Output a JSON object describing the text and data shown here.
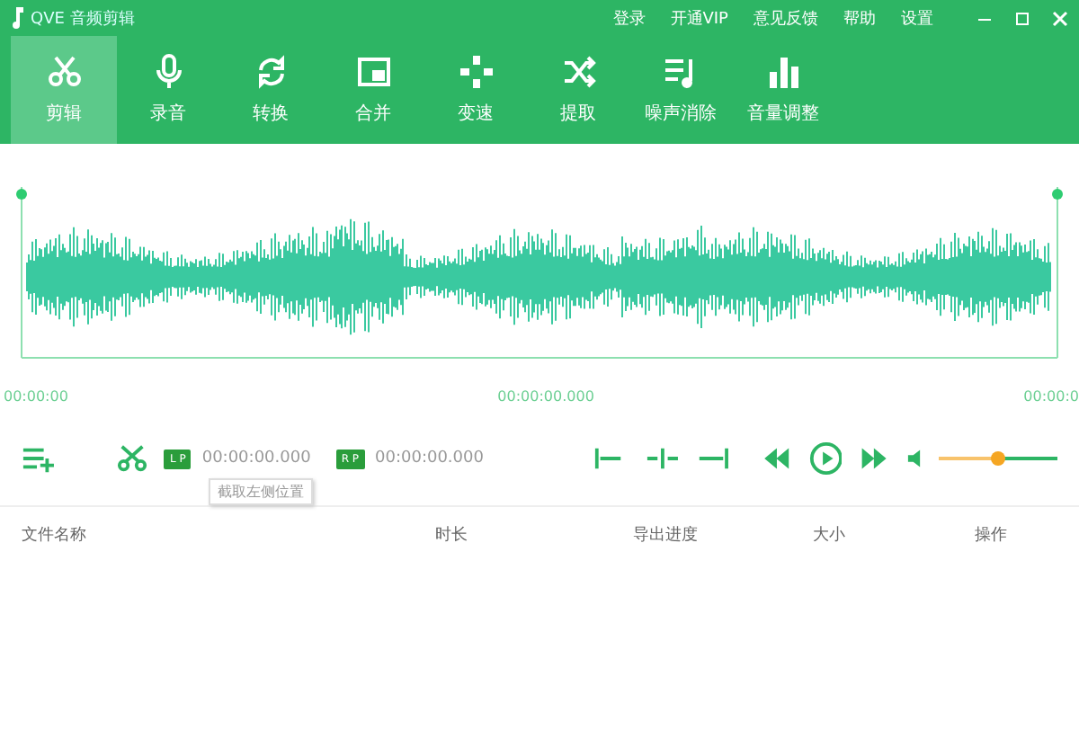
{
  "window": {
    "title": "QVE 音频剪辑"
  },
  "top_links": [
    "登录",
    "开通VIP",
    "意见反馈",
    "帮助",
    "设置"
  ],
  "tools": [
    {
      "label": "剪辑",
      "kind": "scissors",
      "selected": true
    },
    {
      "label": "录音",
      "kind": "mic",
      "selected": false
    },
    {
      "label": "转换",
      "kind": "convert",
      "selected": false
    },
    {
      "label": "合并",
      "kind": "merge",
      "selected": false
    },
    {
      "label": "变速",
      "kind": "speed",
      "selected": false
    },
    {
      "label": "提取",
      "kind": "shuffle",
      "selected": false
    },
    {
      "label": "噪声消除",
      "kind": "noise",
      "selected": false
    },
    {
      "label": "音量调整",
      "kind": "bars",
      "selected": false
    }
  ],
  "timeline": {
    "start": "00:00:00",
    "middle": "00:00:00.000",
    "end": "00:00:0"
  },
  "controls": {
    "left_point": {
      "badge": "L P",
      "time": "00:00:00.000"
    },
    "right_point": {
      "badge": "R P",
      "time": "00:00:00.000"
    },
    "tooltip": "截取左侧位置",
    "volume": {
      "level": 0.5
    }
  },
  "table": {
    "columns": [
      "文件名称",
      "时长",
      "导出进度",
      "大小",
      "操作"
    ]
  }
}
